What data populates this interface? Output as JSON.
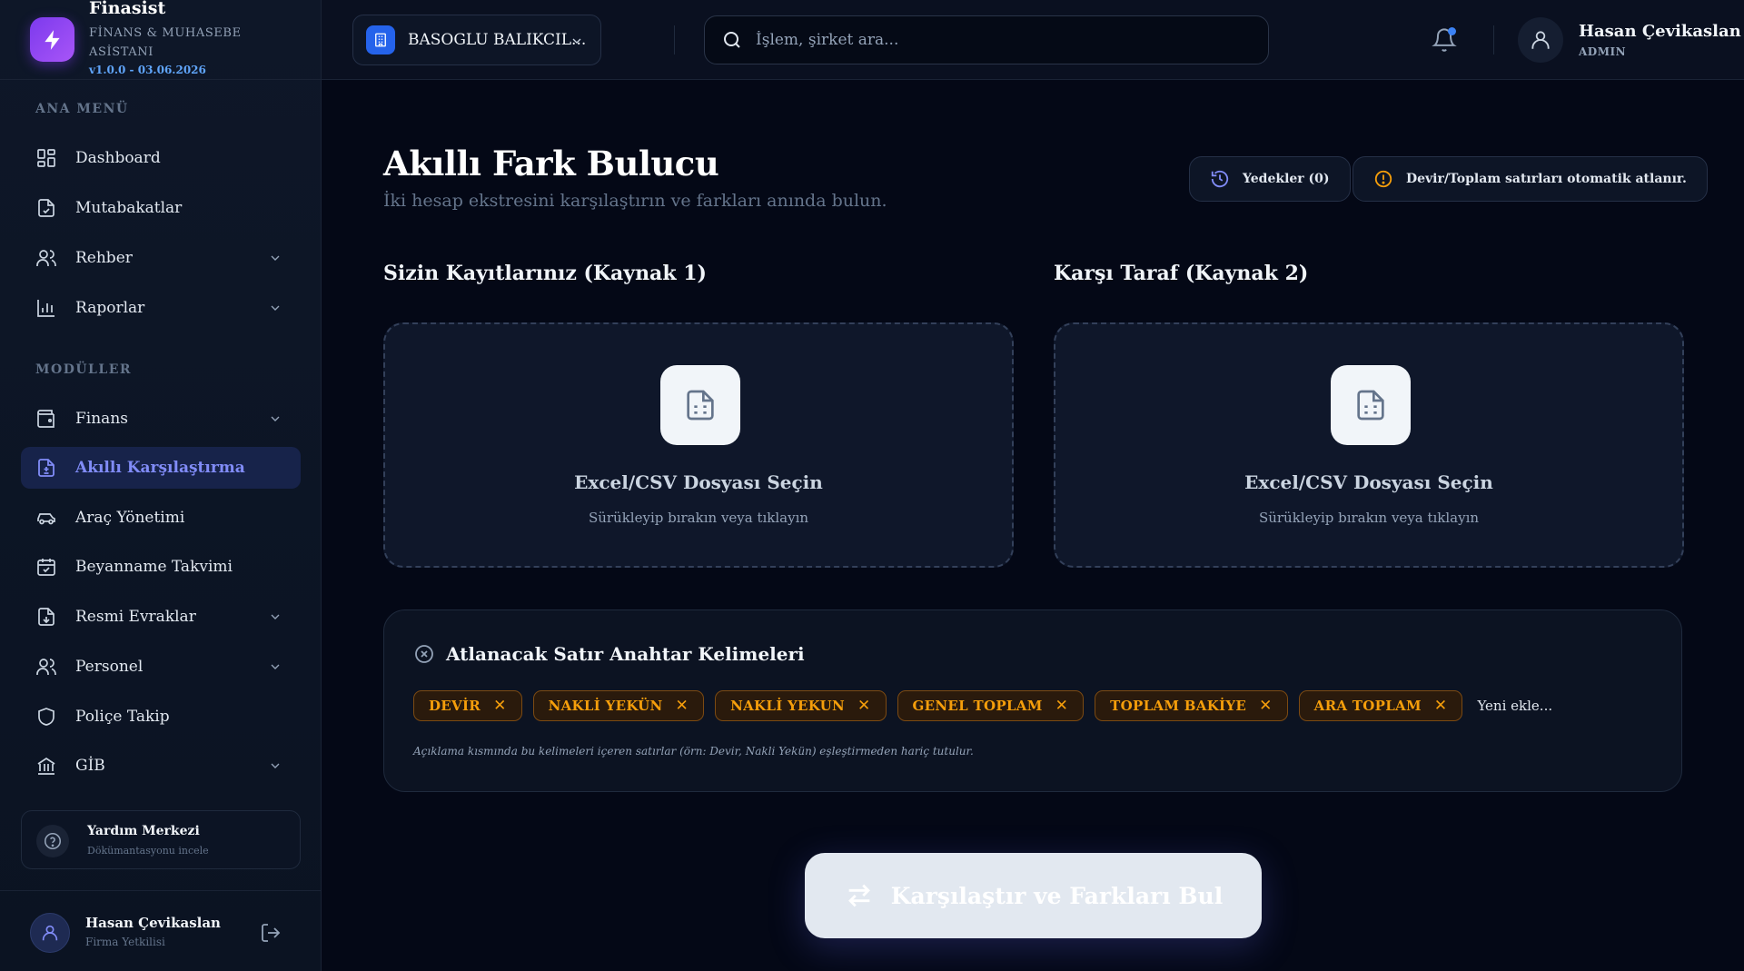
{
  "brand": {
    "title": "Finasist",
    "subtitle": "FİNANS & MUHASEBE ASİSTANI",
    "version": "v1.0.0 - 03.06.2026"
  },
  "sidebar": {
    "section_main": "ANA MENÜ",
    "section_modules": "MODÜLLER",
    "main_items": [
      {
        "label": "Dashboard",
        "icon": "dashboard-icon"
      },
      {
        "label": "Mutabakatlar",
        "icon": "document-check-icon"
      },
      {
        "label": "Rehber",
        "icon": "users-icon"
      },
      {
        "label": "Raporlar",
        "icon": "bar-chart-icon"
      }
    ],
    "module_items": [
      {
        "label": "Finans",
        "icon": "wallet-icon"
      },
      {
        "label": "Akıllı Karşılaştırma",
        "icon": "file-diff-icon"
      },
      {
        "label": "Araç Yönetimi",
        "icon": "car-icon"
      },
      {
        "label": "Beyanname Takvimi",
        "icon": "calendar-icon"
      },
      {
        "label": "Resmi Evraklar",
        "icon": "file-icon"
      },
      {
        "label": "Personel",
        "icon": "users-icon"
      },
      {
        "label": "Poliçe Takip",
        "icon": "shield-icon"
      },
      {
        "label": "GİB",
        "icon": "bank-icon"
      }
    ],
    "help": {
      "title": "Yardım Merkezi",
      "subtitle": "Dökümantasyonu incele"
    },
    "user": {
      "name": "Hasan Çevikaslan",
      "role": "Firma Yetkilisi"
    }
  },
  "header": {
    "company": "BASOGLU BALIKCIL...",
    "search_placeholder": "İşlem, şirket ara...",
    "user_name": "Hasan Çevikaslan",
    "user_role": "ADMIN"
  },
  "main": {
    "title": "Akıllı Fark Bulucu",
    "subtitle": "İki hesap ekstresini karşılaştırın ve farkları anında bulun.",
    "backups_label": "Yedekler (0)",
    "notice_label": "Devir/Toplam satırları otomatik atlanır.",
    "source1_title": "Sizin Kayıtlarınız (Kaynak 1)",
    "source2_title": "Karşı Taraf (Kaynak 2)",
    "drop_title": "Excel/CSV Dosyası Seçin",
    "drop_subtitle": "Sürükleyip bırakın veya tıklayın",
    "keywords_title": "Atlanacak Satır Anahtar Kelimeleri",
    "keywords": [
      "DEVİR",
      "NAKLİ YEKÜN",
      "NAKLİ YEKUN",
      "GENEL TOPLAM",
      "TOPLAM BAKİYE",
      "ARA TOPLAM"
    ],
    "keyword_input_placeholder": "Yeni ekle...",
    "keywords_note": "Açıklama kısmında bu kelimeleri içeren satırlar (örn: Devir, Nakli Yekün) eşleştirmeden hariç tutulur.",
    "compare_button": "Karşılaştır ve Farkları Bul"
  },
  "colors": {
    "accent": "#818cf8",
    "chip_text": "#f59e0b",
    "brand": "#7c3aed"
  }
}
